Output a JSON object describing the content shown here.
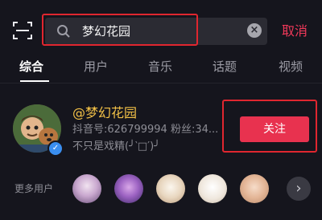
{
  "header": {
    "scan_icon": "scan-icon",
    "search_icon": "search-icon",
    "search_value": "梦幻花园",
    "clear_icon": "clear-icon",
    "clear_glyph": "×",
    "cancel_label": "取消"
  },
  "tabs": [
    {
      "label": "综合",
      "active": true
    },
    {
      "label": "用户",
      "active": false
    },
    {
      "label": "音乐",
      "active": false
    },
    {
      "label": "话题",
      "active": false
    },
    {
      "label": "视频",
      "active": false
    }
  ],
  "user": {
    "name": "@梦幻花园",
    "id_line": "抖音号:626799994  粉丝:34...",
    "signature": "不只是戏精(╯‵□′)╯",
    "verified_glyph": "✓",
    "follow_label": "关注"
  },
  "more_users": {
    "label": "更多用户",
    "next_glyph": "›"
  },
  "colors": {
    "accent": "#e8324f",
    "highlight": "#e0262f",
    "username": "#f4c247",
    "background": "#15151d"
  }
}
